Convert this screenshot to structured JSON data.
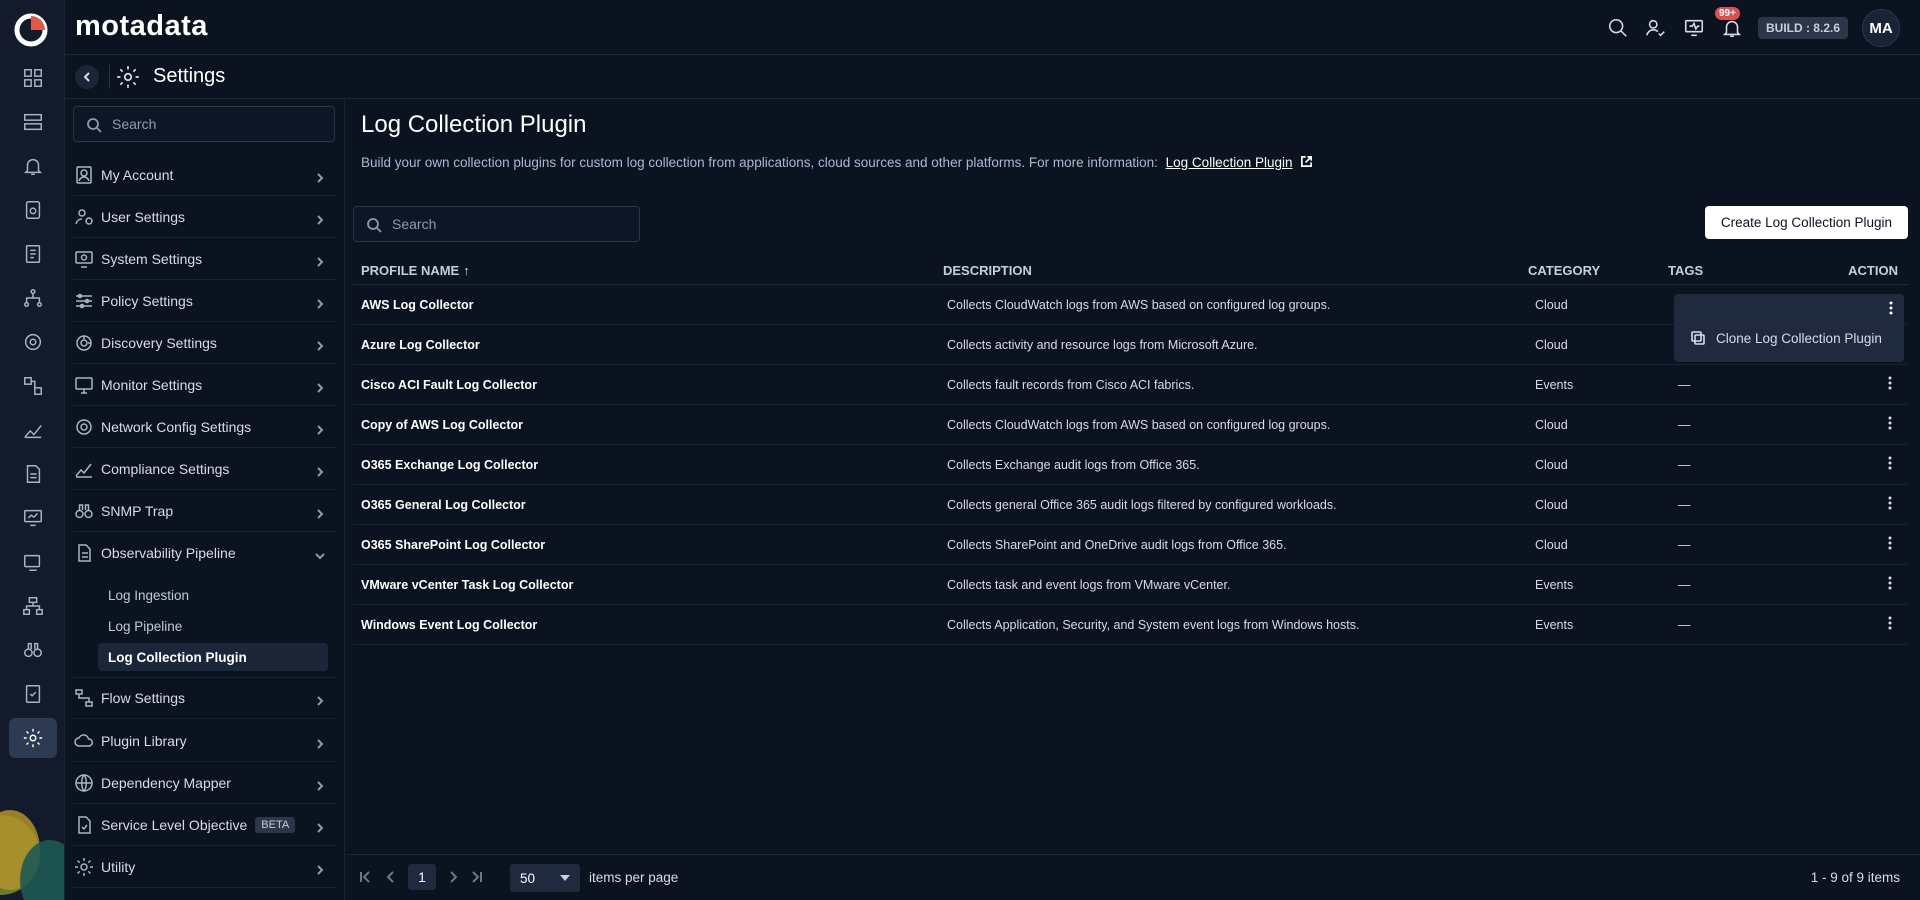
{
  "brand": "motadata",
  "topbar": {
    "notification_count": "99+",
    "build": "BUILD : 8.2.6",
    "avatar_initials": "MA"
  },
  "settings_header": {
    "title": "Settings"
  },
  "sidebar": {
    "search_placeholder": "Search",
    "items": [
      {
        "label": "My Account",
        "icon": "user-card-icon"
      },
      {
        "label": "User Settings",
        "icon": "user-gear-icon"
      },
      {
        "label": "System Settings",
        "icon": "monitor-gear-icon"
      },
      {
        "label": "Policy Settings",
        "icon": "sliders-icon"
      },
      {
        "label": "Discovery Settings",
        "icon": "discovery-icon"
      },
      {
        "label": "Monitor Settings",
        "icon": "monitor-icon"
      },
      {
        "label": "Network Config Settings",
        "icon": "network-config-icon"
      },
      {
        "label": "Compliance Settings",
        "icon": "chart-icon"
      },
      {
        "label": "SNMP Trap",
        "icon": "binoculars-icon"
      },
      {
        "label": "Observability Pipeline",
        "icon": "document-icon"
      },
      {
        "label": "Flow Settings",
        "icon": "flow-icon"
      },
      {
        "label": "Plugin Library",
        "icon": "cloud-icon"
      },
      {
        "label": "Dependency Mapper",
        "icon": "globe-icon"
      },
      {
        "label": "Service Level Objective",
        "icon": "slo-icon",
        "badge": "BETA"
      },
      {
        "label": "Utility",
        "icon": "gear-icon"
      }
    ],
    "sub_items": [
      "Log Ingestion",
      "Log Pipeline",
      "Log Collection Plugin"
    ]
  },
  "page": {
    "title": "Log Collection Plugin",
    "description": "Build your own collection plugins for custom log collection from applications, cloud sources and other platforms. For more information:",
    "link_text": "Log Collection Plugin",
    "search_placeholder": "Search",
    "create_button": "Create Log Collection Plugin"
  },
  "table": {
    "headers": {
      "name": "PROFILE NAME",
      "description": "DESCRIPTION",
      "category": "CATEGORY",
      "tags": "TAGS",
      "action": "ACTION"
    },
    "sort_indicator": "↑",
    "rows": [
      {
        "name": "AWS Log Collector",
        "description": "Collects CloudWatch logs from AWS based on configured log groups.",
        "category": "Cloud",
        "tags": ""
      },
      {
        "name": "Azure Log Collector",
        "description": "Collects activity and resource logs from Microsoft Azure.",
        "category": "Cloud",
        "tags": ""
      },
      {
        "name": "Cisco ACI Fault Log Collector",
        "description": "Collects fault records from Cisco ACI fabrics.",
        "category": "Events",
        "tags": "—"
      },
      {
        "name": "Copy of AWS Log Collector",
        "description": "Collects CloudWatch logs from AWS based on configured log groups.",
        "category": "Cloud",
        "tags": "—"
      },
      {
        "name": "O365 Exchange Log Collector",
        "description": "Collects Exchange audit logs from Office 365.",
        "category": "Cloud",
        "tags": "—"
      },
      {
        "name": "O365 General Log Collector",
        "description": "Collects general Office 365 audit logs filtered by configured workloads.",
        "category": "Cloud",
        "tags": "—"
      },
      {
        "name": "O365 SharePoint Log Collector",
        "description": "Collects SharePoint and OneDrive audit logs from Office 365.",
        "category": "Cloud",
        "tags": "—"
      },
      {
        "name": "VMware vCenter Task Log Collector",
        "description": "Collects task and event logs from VMware vCenter.",
        "category": "Events",
        "tags": "—"
      },
      {
        "name": "Windows Event Log Collector",
        "description": "Collects Application, Security, and System event logs from Windows hosts.",
        "category": "Events",
        "tags": "—"
      }
    ]
  },
  "context_menu": {
    "item": "Clone Log Collection Plugin"
  },
  "pagination": {
    "current_page": "1",
    "page_size": "50",
    "per_page_label": "items per page",
    "range": "1 - 9 of 9 items"
  }
}
